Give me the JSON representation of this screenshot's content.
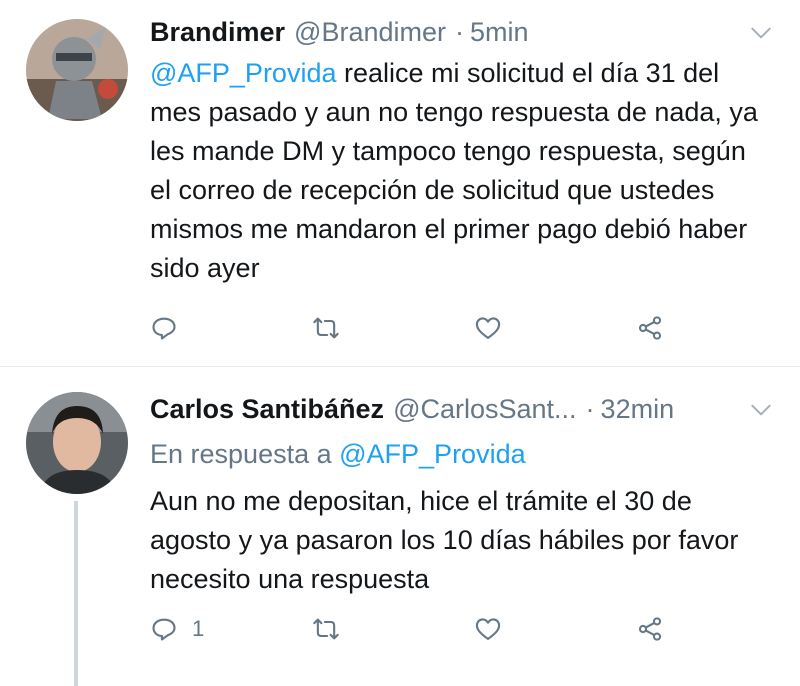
{
  "tweets": [
    {
      "name": "Brandimer",
      "handle": "@Brandimer",
      "separator": "·",
      "time": "5min",
      "mention": "@AFP_Provida",
      "text": " realice mi solicitud el día 31 del mes pasado y aun no tengo respuesta de nada, ya les mande DM y tampoco tengo respuesta, según el correo de recepción de solicitud que ustedes mismos me mandaron el primer pago debió haber sido ayer",
      "reply_count": ""
    },
    {
      "name": "Carlos Santibáñez",
      "handle": "@CarlosSant...",
      "separator": "·",
      "time": "32min",
      "reply_prefix": "En respuesta a ",
      "reply_handle": "@AFP_Provida",
      "text": "Aun no me depositan, hice el trámite el 30 de agosto y ya pasaron los 10 días hábiles por favor necesito una respuesta",
      "reply_count": "1"
    }
  ],
  "icons": {
    "reply": "reply-icon",
    "retweet": "retweet-icon",
    "like": "heart-icon",
    "share": "share-icon",
    "more": "chevron-down-icon"
  },
  "colors": {
    "link": "#1da1f2",
    "secondary_text": "#657786",
    "icon": "#657786",
    "divider": "#e6ecf0"
  }
}
